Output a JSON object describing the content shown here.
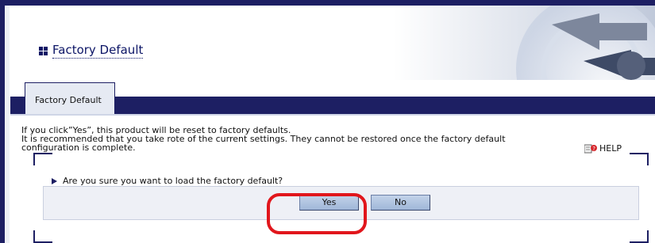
{
  "page": {
    "title": "Factory Default"
  },
  "tabs": [
    {
      "label": "Factory Default",
      "active": true
    }
  ],
  "description": {
    "line1": "If you click”Yes”, this product will be reset to factory defaults.",
    "line2": "It is recommended that you take rote of the current settings. They cannot be restored once the factory default",
    "line3": "configuration is complete."
  },
  "help": {
    "label": "HELP",
    "icon": "help-book-icon"
  },
  "confirm": {
    "question": "Are you sure you want to load the factory default?",
    "yes_label": "Yes",
    "no_label": "No"
  },
  "colors": {
    "frame": "#1d1f63",
    "highlight": "#e1161c",
    "button": "#b3c6e3"
  }
}
